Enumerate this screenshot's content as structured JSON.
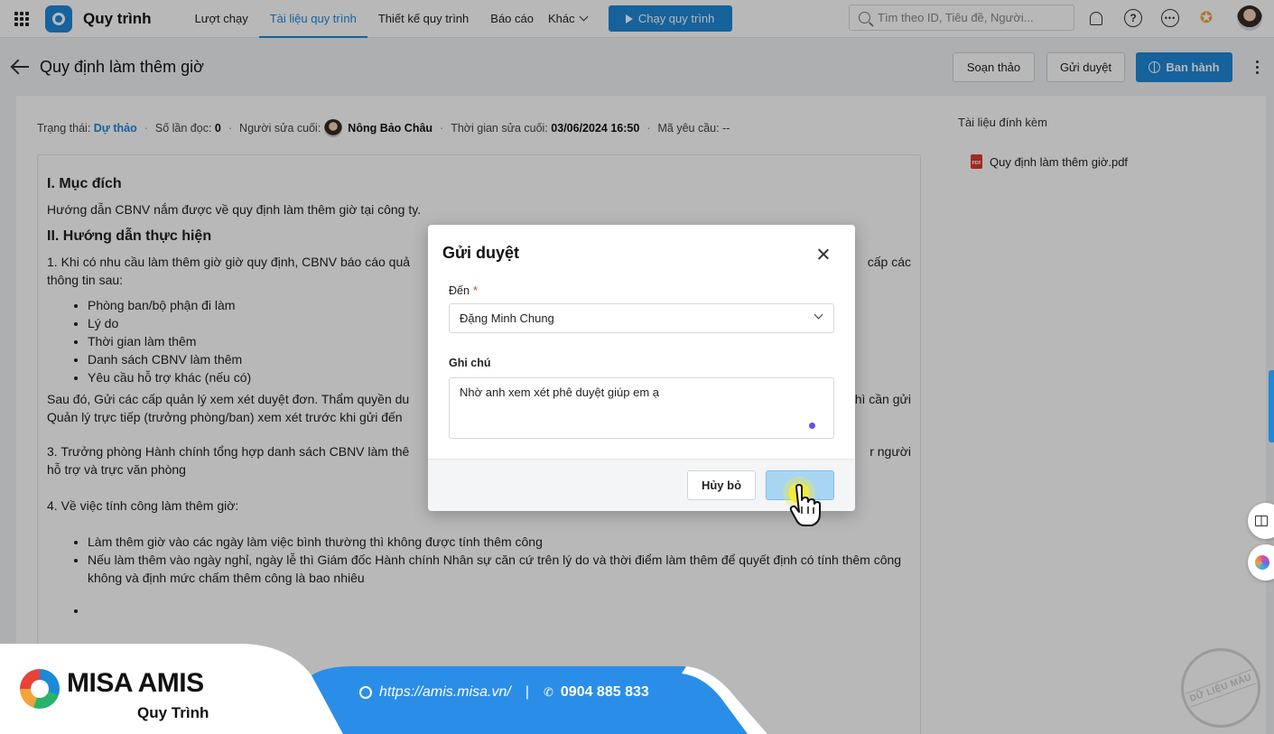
{
  "topbar": {
    "app_title": "Quy trình",
    "nav": [
      "Lượt chạy",
      "Tài liệu quy trình",
      "Thiết kế quy trình",
      "Báo cáo"
    ],
    "more_label": "Khác",
    "run_button": "Chạy quy trình",
    "search_placeholder": "Tìm theo ID, Tiêu đề, Người..."
  },
  "page": {
    "title": "Quy định làm thêm giờ",
    "draft_button": "Soạn thảo",
    "send_button": "Gửi duyệt",
    "publish_button": "Ban hành"
  },
  "meta": {
    "status_label": "Trạng thái:",
    "status_value": "Dự thảo",
    "reads_label": "Số lần đọc:",
    "reads_value": "0",
    "editor_label": "Người sửa cuối:",
    "editor_value": "Nông Bảo Châu",
    "time_label": "Thời gian sửa cuối:",
    "time_value": "03/06/2024 16:50",
    "request_label": "Mã yêu cầu:",
    "request_value": "--"
  },
  "document": {
    "h1": "I. Mục đích",
    "p1": "Hướng dẫn CBNV nắm được về quy định làm thêm giờ tại công ty.",
    "h2": "II. Hướng dẫn thực hiện",
    "p2_left": "1. Khi có nhu cầu làm thêm giờ giờ quy định, CBNV báo cáo quả",
    "p2_right": "cấp các",
    "p2_end": "thông tin sau:",
    "list1": [
      "Phòng ban/bộ phận đi làm",
      "Lý do",
      "Thời gian làm thêm",
      "Danh sách CBNV làm thêm",
      "Yêu cầu hỗ trợ khác (nếu có)"
    ],
    "p3_line1_left": "Sau đó, Gửi các cấp quản lý xem xét duyệt đơn. Thẩm quyền du",
    "p3_line1_right": "hì cần gửi",
    "p3_line2": "Quản lý trực tiếp (trưởng phòng/ban) xem xét trước khi gửi đến",
    "p4_line1_left": "3. Trưởng phòng Hành chính tổng hợp danh sách CBNV làm thê",
    "p4_line1_right": "r người",
    "p4_line2": "hỗ trợ và trực văn phòng",
    "p5": "4. Về việc tính công làm thêm giờ:",
    "list2": [
      "Làm thêm giờ vào các ngày làm việc bình thường thì không được tính thêm công",
      "Nếu làm thêm vào ngày nghỉ, ngày lễ thì Giám đốc Hành chính Nhân sự căn cứ trên lý do và thời điểm làm thêm để quyết định có tính thêm công không và định mức chấm thêm công là bao nhiêu"
    ]
  },
  "attachments": {
    "title": "Tài liệu đính kèm",
    "file": "Quy định làm thêm giờ.pdf",
    "file_icon_text": "PDF"
  },
  "dialog": {
    "title": "Gửi duyệt",
    "to_label": "Đến",
    "required_mark": "*",
    "to_value": "Đặng Minh Chung",
    "note_label": "Ghi chú",
    "note_value": "Nhờ anh xem xét phê duyệt giúp em ạ",
    "cancel_button": "Hủy bỏ",
    "confirm_button": ""
  },
  "stamp": {
    "text": "DỮ LIỆU MẪU"
  },
  "brand": {
    "name": "MISA AMIS",
    "sub": "Quy Trình",
    "url": "https://amis.misa.vn/",
    "separator": "|",
    "phone": "0904 885 833"
  },
  "colors": {
    "primary": "#1e88d9",
    "danger": "#e0392b",
    "band": "#2a8ee8"
  }
}
